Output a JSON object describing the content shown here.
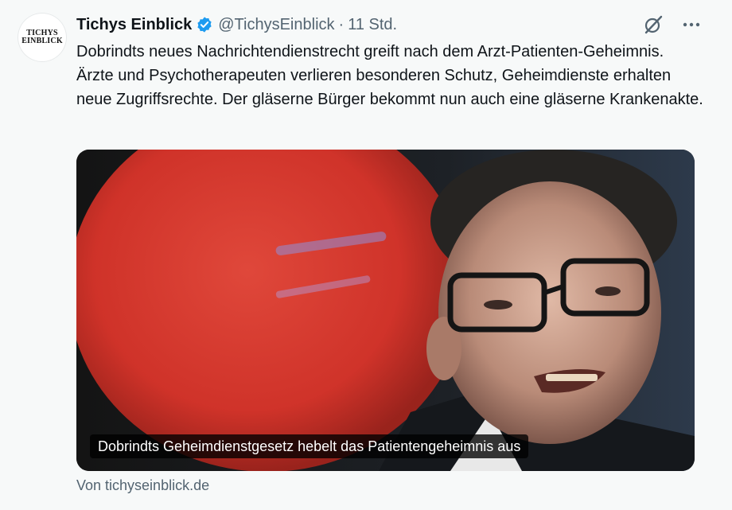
{
  "account": {
    "display_name": "Tichys Einblick",
    "handle": "@TichysEinblick",
    "separator": "·",
    "time": "11 Std.",
    "avatar_line1": "TICHYS",
    "avatar_line2": "EINBLICK",
    "verified_icon": "verified-badge-icon",
    "verified_color": "#1d9bf0"
  },
  "header_actions": {
    "grok_icon": "grok-slash-icon",
    "more_icon": "more-horizontal-icon",
    "more_label": "···"
  },
  "tweet": {
    "text": "Dobrindts neues Nachrichtendienstrecht greift nach dem Arzt-Patienten-Geheimnis. Ärzte und Psychotherapeuten verlieren besonderen Schutz, Geheimdienste erhalten neue Zugriffsrechte. Der gläserne Bürger bekommt nun auch eine gläserne Krankenakte."
  },
  "card": {
    "caption": "Dobrindts Geheimdienstgesetz hebelt das Patientengeheimnis aus",
    "source": "Von tichyseinblick.de"
  },
  "colors": {
    "background": "#f7f9f9",
    "text": "#0f1419",
    "secondary": "#536471",
    "accent_red": "#e0392b"
  }
}
